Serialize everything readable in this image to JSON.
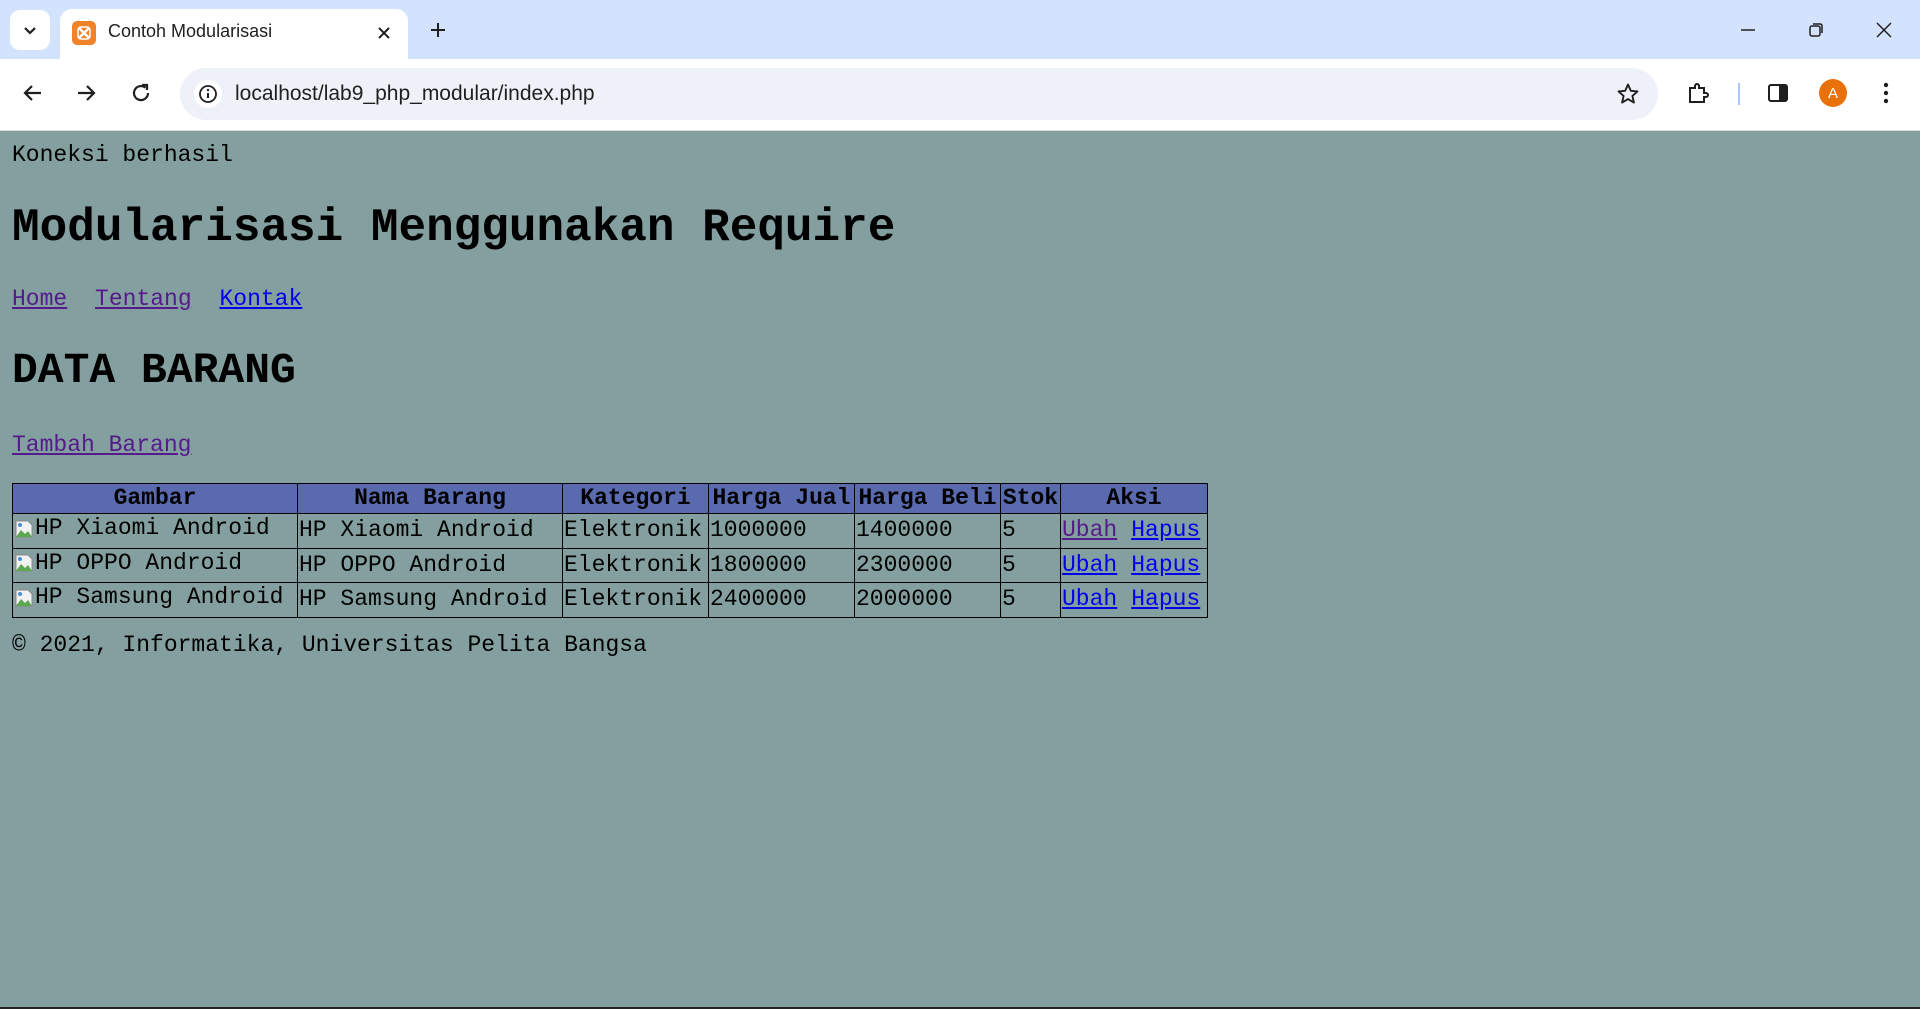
{
  "browser": {
    "tab": {
      "title": "Contoh Modularisasi"
    },
    "url": "localhost/lab9_php_modular/index.php",
    "profile_initial": "A"
  },
  "page": {
    "status": "Koneksi berhasil",
    "title": "Modularisasi Menggunakan Require",
    "nav": [
      "Home",
      "Tentang",
      "Kontak"
    ],
    "section_title": "DATA BARANG",
    "add_link": "Tambah Barang",
    "table": {
      "headers": [
        "Gambar",
        "Nama Barang",
        "Kategori",
        "Harga Jual",
        "Harga Beli",
        "Stok",
        "Aksi"
      ],
      "rows": [
        {
          "gambar": "HP Xiaomi Android",
          "nama": "HP Xiaomi Android",
          "kategori": "Elektronik",
          "harga_jual": "1000000",
          "harga_beli": "1400000",
          "stok": "5",
          "ubah": "Ubah",
          "hapus": "Hapus"
        },
        {
          "gambar": "HP OPPO Android",
          "nama": "HP OPPO Android",
          "kategori": "Elektronik",
          "harga_jual": "1800000",
          "harga_beli": "2300000",
          "stok": "5",
          "ubah": "Ubah",
          "hapus": "Hapus"
        },
        {
          "gambar": "HP Samsung Android",
          "nama": "HP Samsung Android",
          "kategori": "Elektronik",
          "harga_jual": "2400000",
          "harga_beli": "2000000",
          "stok": "5",
          "ubah": "Ubah",
          "hapus": "Hapus"
        }
      ]
    },
    "footer": "© 2021, Informatika, Universitas Pelita Bangsa"
  },
  "colors": {
    "page_background": "#849f9f",
    "table_header": "#5a6aaf",
    "tabstrip": "#d3e3fd",
    "avatar": "#e8710a"
  },
  "icons": [
    "tab-search-icon",
    "xampp-favicon-icon",
    "close-icon",
    "plus-icon",
    "minimize-icon",
    "restore-icon",
    "back-icon",
    "forward-icon",
    "reload-icon",
    "site-info-icon",
    "star-icon",
    "extensions-icon",
    "side-panel-icon",
    "menu-icon",
    "broken-image-icon"
  ]
}
